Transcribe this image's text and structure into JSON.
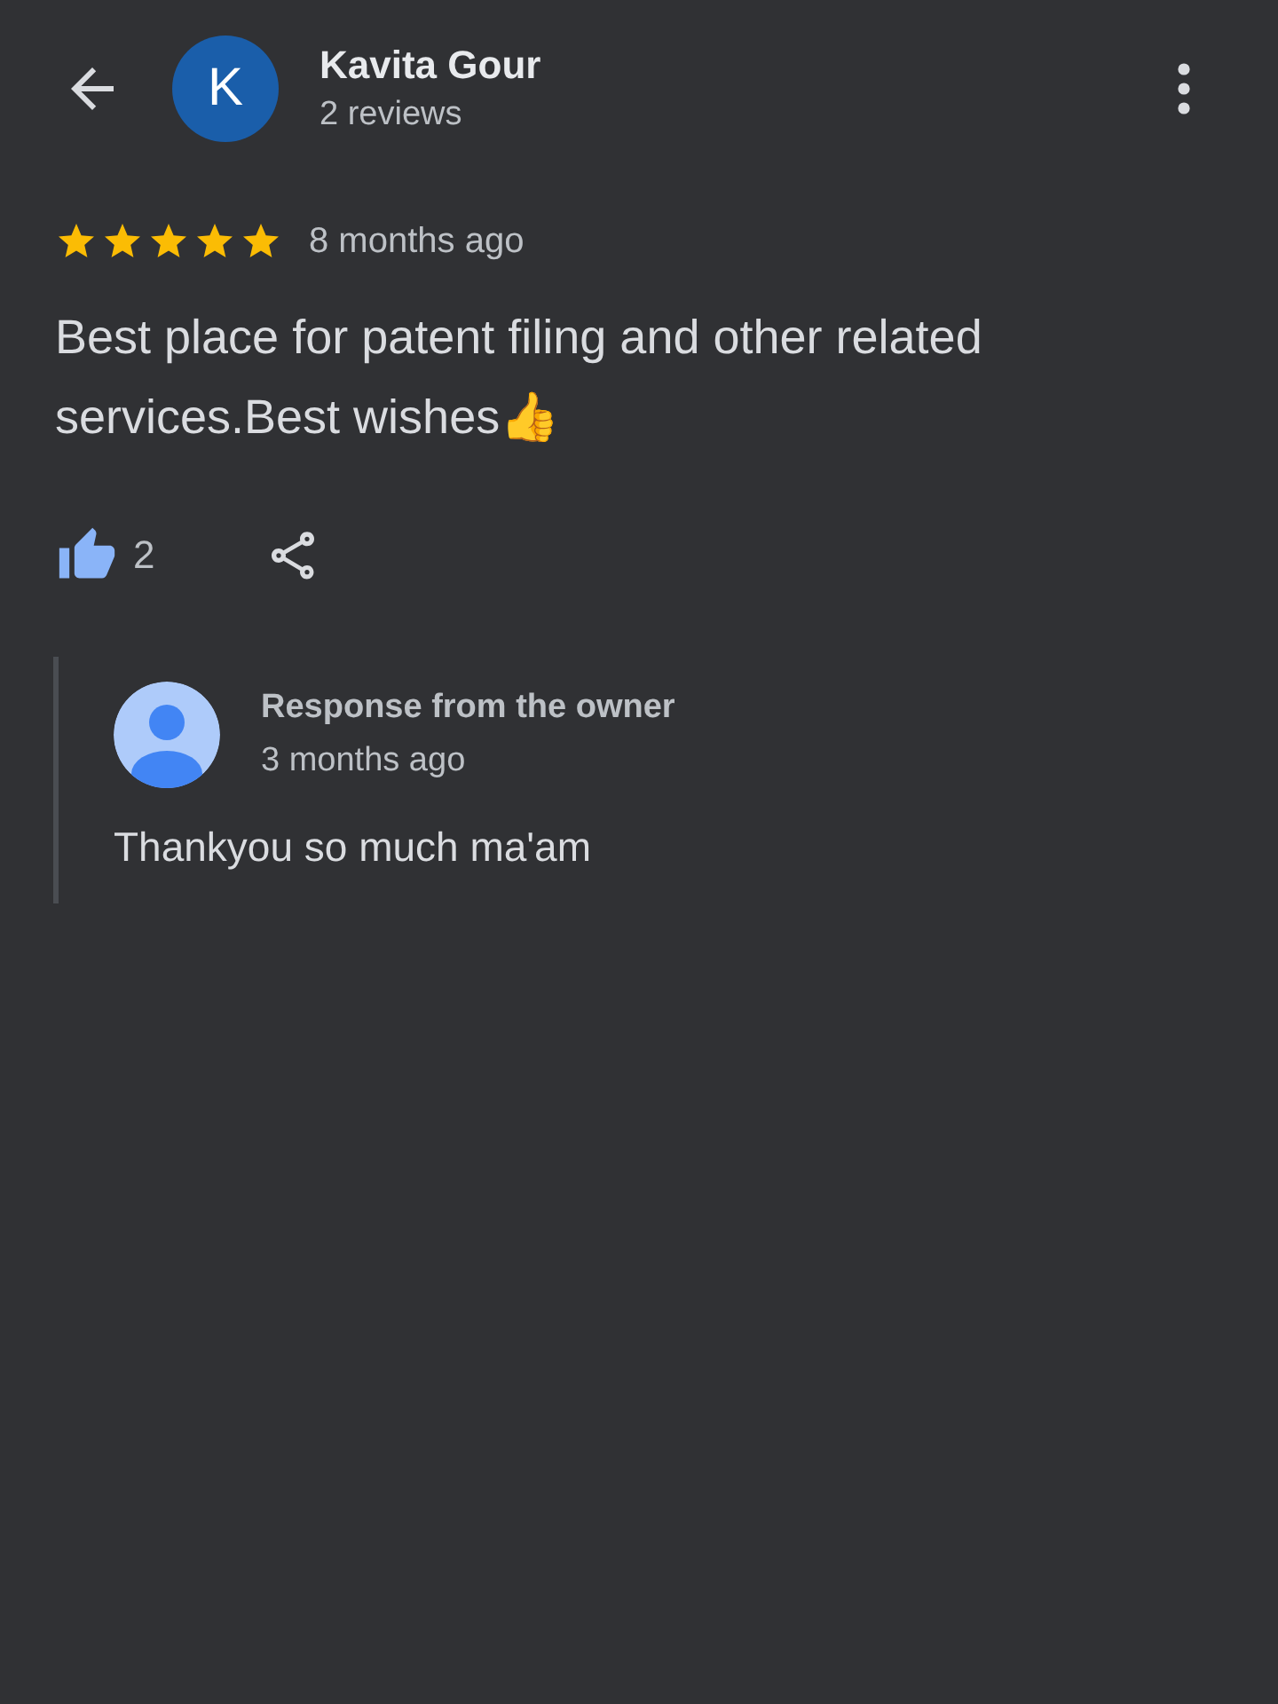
{
  "reviewer": {
    "initial": "K",
    "name": "Kavita Gour",
    "review_count": "2 reviews"
  },
  "review": {
    "stars": 5,
    "time": "8 months ago",
    "text": "Best place for patent filing and other related services.Best wishes👍",
    "likes": "2"
  },
  "owner_response": {
    "title": "Response from the owner",
    "time": "3 months ago",
    "text": "Thankyou so much ma'am"
  }
}
